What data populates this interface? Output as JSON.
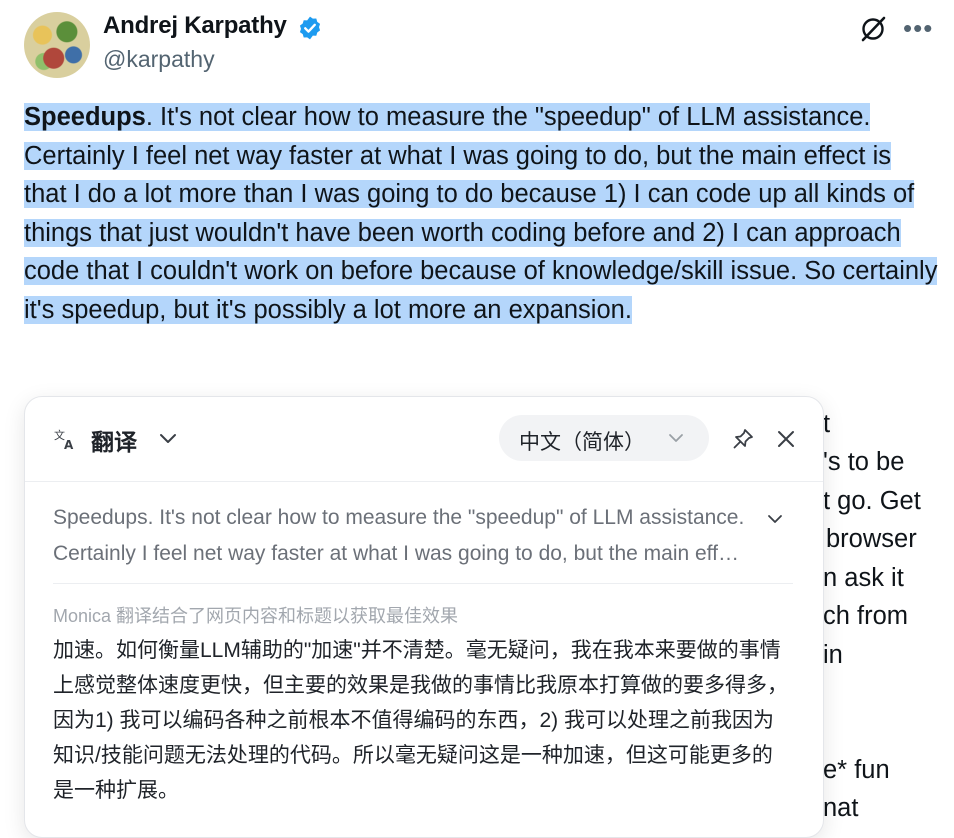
{
  "author": {
    "name": "Andrej Karpathy",
    "handle": "@karpathy"
  },
  "tweet": {
    "bold_lead": "Speedups",
    "text": ". It's not clear how to measure the \"speedup\" of LLM assistance. Certainly I feel net way faster at what I was going to do, but the main effect is that I do a lot more than I was going to do because 1) I can code up all kinds of things that just wouldn't have been worth coding before and 2) I can approach code that I couldn't work on before because of knowledge/skill issue. So certainly it's speedup, but it's possibly a lot more an expansion."
  },
  "background_fragments": [
    "t",
    "'s to be",
    "t go. Get",
    "browser",
    "n ask it",
    "ch from",
    "in",
    "e* fun",
    "nat"
  ],
  "panel": {
    "title": "翻译",
    "target_language": "中文（简体）",
    "source_text": "Speedups. It's not clear how to measure the \"speedup\" of LLM assistance. Certainly I feel net way faster at what I was going to do, but the main effect is that I do a lot more than I was going to do because 1) I can code up all kinds of things that just wouldn't have been worth coding before and 2) I can approach code that I couldn't work on before because of knowledge/skill issue.",
    "hint": "Monica 翻译结合了网页内容和标题以获取最佳效果",
    "result": "加速。如何衡量LLM辅助的\"加速\"并不清楚。毫无疑问，我在我本来要做的事情上感觉整体速度更快，但主要的效果是我做的事情比我原本打算做的要多得多，因为1) 我可以编码各种之前根本不值得编码的东西，2) 我可以处理之前我因为知识/技能问题无法处理的代码。所以毫无疑问这是一种加速，但这可能更多的是一种扩展。"
  },
  "icons": {
    "verified": "verified-badge-icon",
    "grok": "grok-icon",
    "more": "more-icon",
    "translate": "translate-icon",
    "pin": "pin-icon",
    "close": "close-icon",
    "chevron": "chevron-down-icon"
  },
  "colors": {
    "selection": "#b4d6fb",
    "verified": "#1d9bf0",
    "secondary_text": "#536471"
  }
}
